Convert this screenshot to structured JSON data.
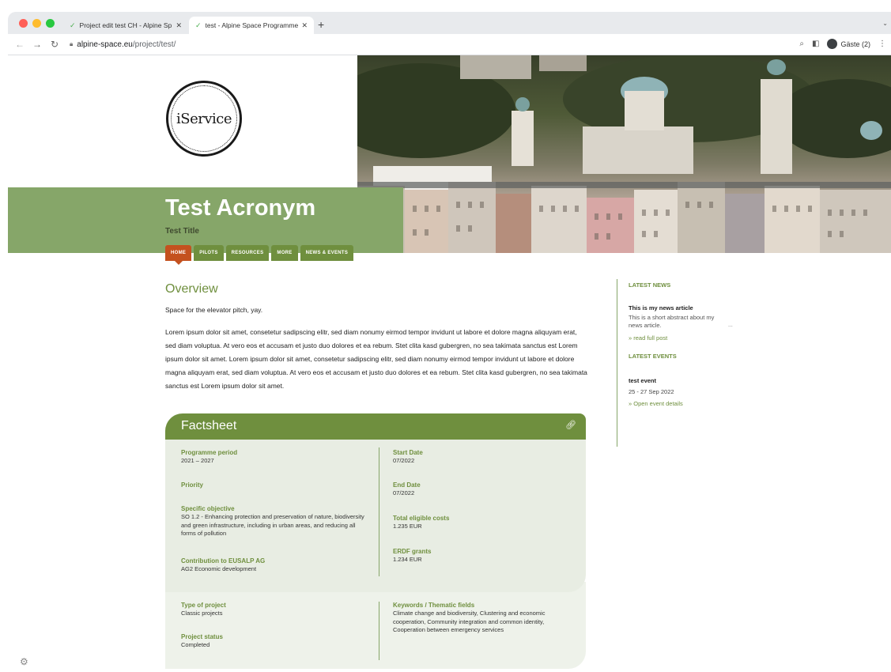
{
  "browser": {
    "tabs": [
      {
        "title": "Project edit test CH - Alpine Sp",
        "active": false
      },
      {
        "title": "test - Alpine Space Programme",
        "active": true
      }
    ],
    "url_domain": "alpine-space.eu",
    "url_path": "/project/test/",
    "profile_label": "Gäste (2)"
  },
  "header": {
    "logo_text": "iService",
    "acronym": "Test Acronym",
    "title": "Test Title"
  },
  "nav": {
    "tabs": [
      "HOME",
      "PILOTS",
      "RESOURCES",
      "MORE",
      "NEWS & EVENTS"
    ],
    "active_index": 0
  },
  "overview": {
    "heading": "Overview",
    "pitch": "Space for the elevator pitch, yay.",
    "body": "Lorem ipsum dolor sit amet, consetetur sadipscing elitr, sed diam nonumy eirmod tempor invidunt ut labore et dolore magna aliquyam erat, sed diam voluptua. At vero eos et accusam et justo duo dolores et ea rebum. Stet clita kasd gubergren, no sea takimata sanctus est Lorem ipsum dolor sit amet. Lorem ipsum dolor sit amet, consetetur sadipscing elitr, sed diam nonumy eirmod tempor invidunt ut labore et dolore magna aliquyam erat, sed diam voluptua. At vero eos et accusam et justo duo dolores et ea rebum. Stet clita kasd gubergren, no sea takimata sanctus est Lorem ipsum dolor sit amet."
  },
  "sidebar": {
    "news_heading": "LATEST NEWS",
    "news_title": "This is my news article",
    "news_abstract": "This is a short abstract about my news article.",
    "news_ellipsis": "...",
    "news_link": "» read full post",
    "events_heading": "LATEST EVENTS",
    "event_title": "test event",
    "event_date": "25 - 27 Sep 2022",
    "event_link": "» Open event details"
  },
  "factsheet": {
    "heading": "Factsheet",
    "left": [
      {
        "label": "Programme period",
        "value": "2021 – 2027"
      },
      {
        "label": "Priority",
        "value": ""
      },
      {
        "label": "Specific objective",
        "value": "SO 1.2 - Enhancing protection and preservation of nature, biodiversity and green infrastructure, including in urban areas, and reducing all forms of pollution"
      },
      {
        "label": "Contribution to EUSALP AG",
        "value": "AG2 Economic development"
      }
    ],
    "right": [
      {
        "label": "Start Date",
        "value": "07/2022"
      },
      {
        "label": "End Date",
        "value": "07/2022"
      },
      {
        "label": "Total eligible costs",
        "value": "1.235 EUR"
      },
      {
        "label": "ERDF grants",
        "value": "1.234 EUR"
      }
    ],
    "bottom_left": [
      {
        "label": "Type of project",
        "value": "Classic projects"
      },
      {
        "label": "Project status",
        "value": "Completed"
      }
    ],
    "bottom_right": [
      {
        "label": "Keywords / Thematic fields",
        "value": "Climate change and biodiversity, Clustering and economic cooperation, Community integration and common identity, Cooperation between emergency services"
      }
    ]
  },
  "colors": {
    "brand_green": "#6f8f3e",
    "band_green": "#86a669",
    "active_tab": "#c4511f",
    "factsheet_bg": "#e8ede3"
  },
  "icons": [
    "tab-favicon-icon",
    "close-icon",
    "plus-icon",
    "back-icon",
    "forward-icon",
    "reload-icon",
    "lock-icon",
    "zoom-icon",
    "sidepanel-icon",
    "profile-icon",
    "more-icon",
    "link-icon",
    "gear-icon"
  ]
}
